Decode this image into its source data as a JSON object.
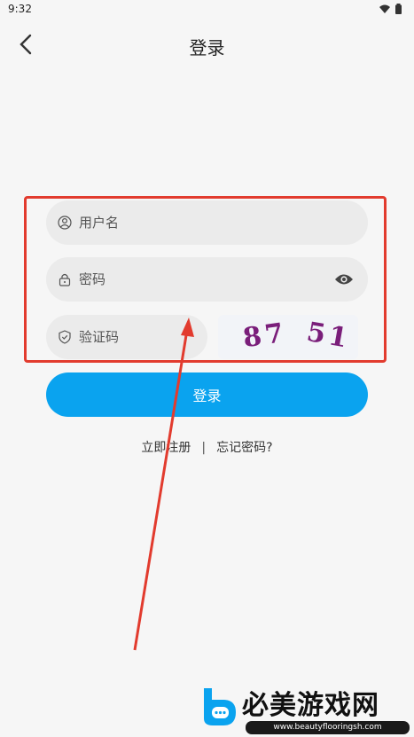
{
  "status": {
    "time": "9:32"
  },
  "header": {
    "title": "登录"
  },
  "form": {
    "username_placeholder": "用户名",
    "password_placeholder": "密码",
    "captcha_placeholder": "验证码",
    "captcha_image_text_1": "87",
    "captcha_image_text_2": "51"
  },
  "login_button": "登录",
  "links": {
    "register": "立即注册",
    "separator": "|",
    "forgot": "忘记密码?"
  },
  "watermark": {
    "title": "必美游戏网",
    "url": "www.beautyflooringsh.com"
  },
  "colors": {
    "accent": "#0aa3ef",
    "highlight": "#e23b2e",
    "background": "#f6f6f6",
    "field": "#ebebeb"
  }
}
